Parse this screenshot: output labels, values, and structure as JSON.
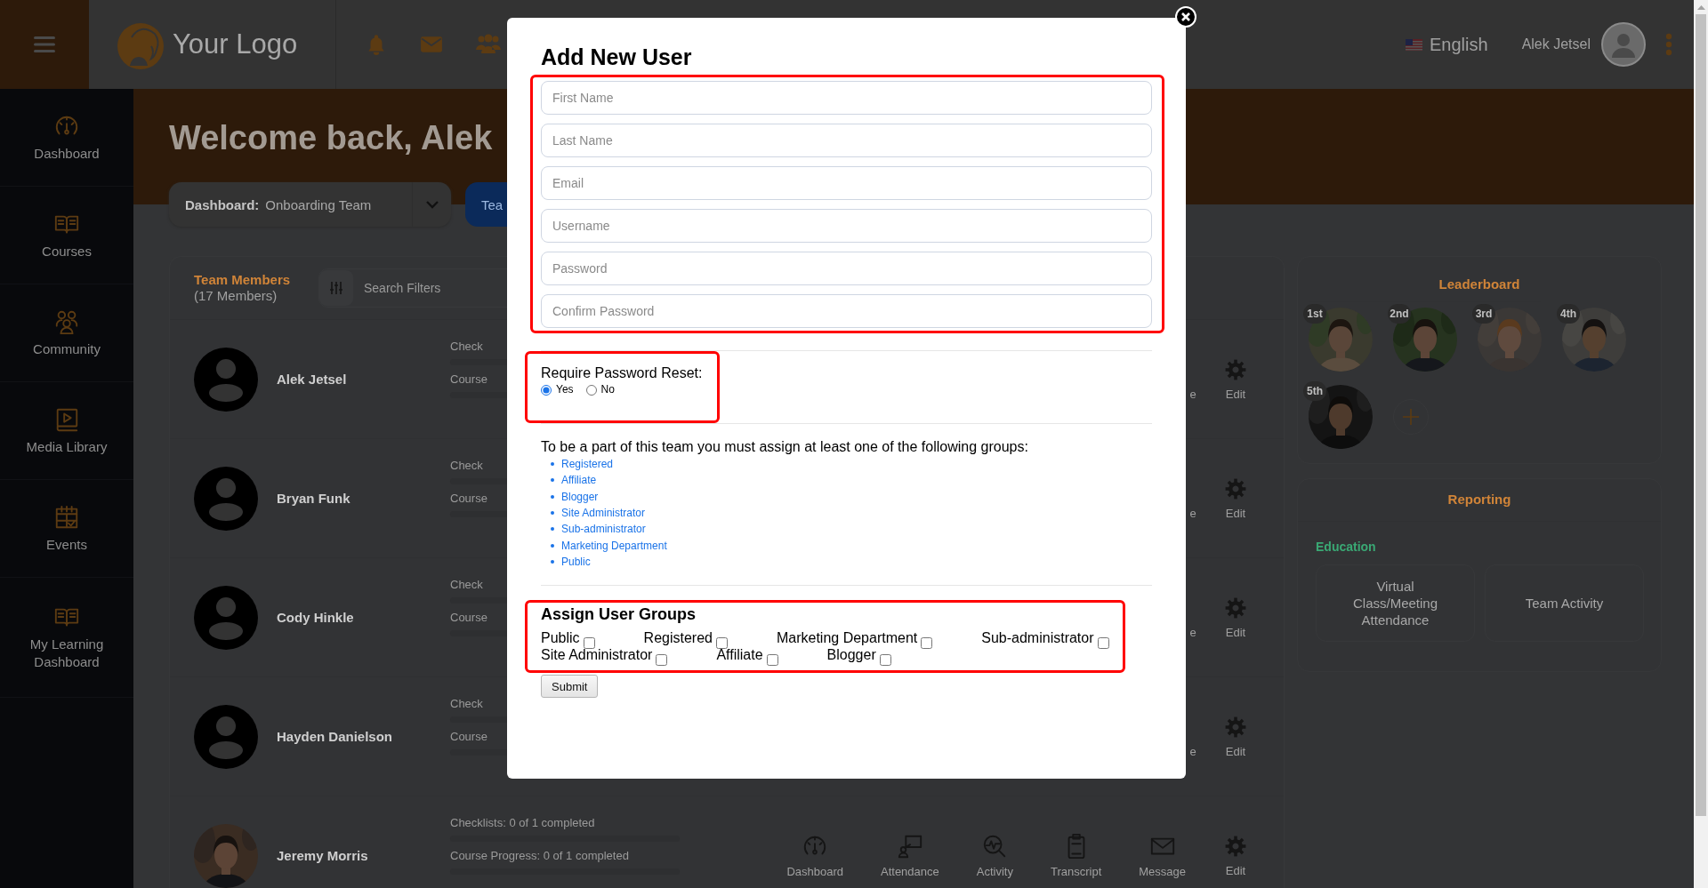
{
  "topbar": {
    "logo_text": "Your Logo",
    "language": "English",
    "user_name": "Alek Jetsel"
  },
  "sidebar": {
    "items": [
      "Dashboard",
      "Courses",
      "Community",
      "Media Library",
      "Events",
      "My Learning Dashboard"
    ]
  },
  "banner": {
    "greeting": "Welcome back, Alek"
  },
  "dashboard_selector": {
    "label": "Dashboard:",
    "value": "Onboarding Team"
  },
  "team_button": {
    "label": "Tea"
  },
  "team_members": {
    "title": "Team Members",
    "count": "(17 Members)",
    "search_filters": "Search Filters",
    "rows": [
      {
        "name": "Alek Jetsel",
        "avatar": {
          "kind": "placeholder"
        },
        "checklists": "Check",
        "course_progress": "Course",
        "action_fragment": "e",
        "edit": "Edit"
      },
      {
        "name": "Bryan Funk",
        "avatar": {
          "kind": "placeholder"
        },
        "checklists": "Check",
        "course_progress": "Course",
        "action_fragment": "e",
        "edit": "Edit"
      },
      {
        "name": "Cody Hinkle",
        "avatar": {
          "kind": "placeholder"
        },
        "checklists": "Check",
        "course_progress": "Course",
        "action_fragment": "e",
        "edit": "Edit"
      },
      {
        "name": "Hayden Danielson",
        "avatar": {
          "kind": "placeholder"
        },
        "checklists": "Check",
        "course_progress": "Course",
        "action_fragment": "e",
        "edit": "Edit"
      },
      {
        "name": "Jeremy Morris",
        "avatar": {
          "kind": "picture"
        },
        "checklists": "Checklists: 0 of 1 completed",
        "course_progress": "Course Progress: 0 of 1 completed",
        "actions": [
          "Dashboard",
          "Attendance",
          "Activity",
          "Transcript",
          "Message"
        ],
        "edit": "Edit"
      }
    ]
  },
  "leaderboard": {
    "title": "Leaderboard",
    "leaders": [
      {
        "rank": "1st"
      },
      {
        "rank": "2nd"
      },
      {
        "rank": "3rd"
      },
      {
        "rank": "4th"
      },
      {
        "rank": "5th"
      }
    ]
  },
  "reporting": {
    "title": "Reporting",
    "section": "Education",
    "tiles": [
      "Virtual Class/Meeting Attendance",
      "Team Activity"
    ]
  },
  "modal": {
    "title": "Add New User",
    "fields": [
      {
        "placeholder": "First Name"
      },
      {
        "placeholder": "Last Name"
      },
      {
        "placeholder": "Email"
      },
      {
        "placeholder": "Username"
      },
      {
        "placeholder": "Password"
      },
      {
        "placeholder": "Confirm Password"
      }
    ],
    "password_reset": {
      "label": "Require Password Reset:",
      "options": [
        {
          "label": "Yes",
          "selected": true
        },
        {
          "label": "No",
          "selected": false
        }
      ]
    },
    "groups_note": "To be a part of this team you must assign at least one of the following groups:",
    "required_groups": [
      "Registered",
      "Affiliate",
      "Blogger",
      "Site Administrator",
      "Sub-administrator",
      "Marketing Department",
      "Public"
    ],
    "assign_groups": {
      "title": "Assign User Groups",
      "groups": [
        {
          "label": "Public",
          "checked": false
        },
        {
          "label": "Registered",
          "checked": false
        },
        {
          "label": "Marketing Department",
          "checked": false
        },
        {
          "label": "Sub-administrator",
          "checked": false
        },
        {
          "label": "Site Administrator",
          "checked": false
        },
        {
          "label": "Affiliate",
          "checked": false
        },
        {
          "label": "Blogger",
          "checked": false
        }
      ]
    },
    "submit": "Submit"
  }
}
